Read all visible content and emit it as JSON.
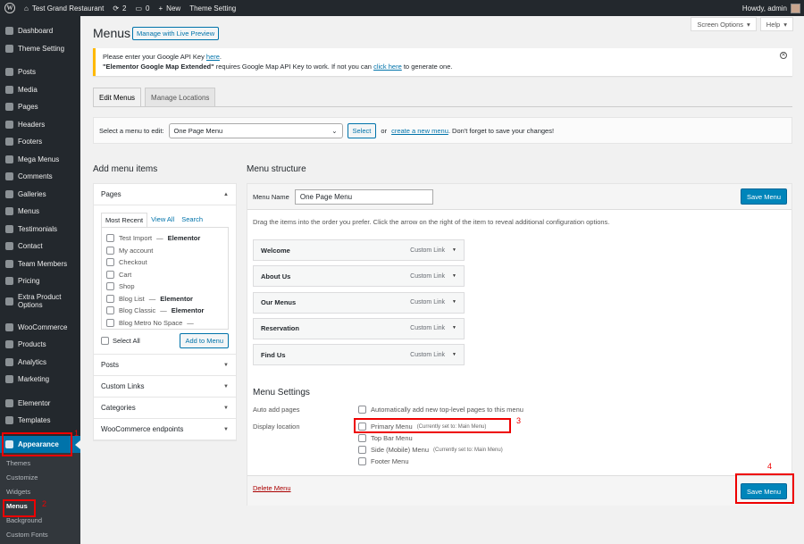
{
  "adminbar": {
    "site": "Test Grand Restaurant",
    "updates": "2",
    "comments": "0",
    "new": "New",
    "theme_setting": "Theme Setting",
    "howdy": "Howdy, admin"
  },
  "sidebar": {
    "items": [
      "Dashboard",
      "Theme Setting",
      "Posts",
      "Media",
      "Pages",
      "Headers",
      "Footers",
      "Mega Menus",
      "Comments",
      "Galleries",
      "Menus",
      "Testimonials",
      "Contact",
      "Team Members",
      "Pricing",
      "Extra Product Options",
      "WooCommerce",
      "Products",
      "Analytics",
      "Marketing",
      "Elementor",
      "Templates",
      "Appearance"
    ],
    "sub": [
      "Themes",
      "Customize",
      "Widgets",
      "Menus",
      "Background",
      "Custom Fonts"
    ]
  },
  "header": {
    "title": "Menus",
    "preview_button": "Manage with Live Preview",
    "screen_options": "Screen Options",
    "help": "Help"
  },
  "notice": {
    "line1_pre": "Please enter your Google API Key ",
    "line1_link": "here",
    "line1_post": ".",
    "line2_bold": "\"Elementor Google Map Extended\"",
    "line2_mid": " requires Google Map API Key to work. If not you can ",
    "line2_link": "click here",
    "line2_post": " to generate one."
  },
  "tabs": [
    "Edit Menus",
    "Manage Locations"
  ],
  "select_bar": {
    "label": "Select a menu to edit:",
    "selected": "One Page Menu",
    "select_button": "Select",
    "or": "or",
    "create_link": "create a new menu",
    "suffix": ". Don't forget to save your changes!"
  },
  "add_items": {
    "title": "Add menu items",
    "pages_heading": "Pages",
    "page_tabs": [
      "Most Recent",
      "View All",
      "Search"
    ],
    "pages": [
      {
        "name": "Test Import",
        "suffix": "Elementor"
      },
      {
        "name": "My account",
        "suffix": ""
      },
      {
        "name": "Checkout",
        "suffix": ""
      },
      {
        "name": "Cart",
        "suffix": ""
      },
      {
        "name": "Shop",
        "suffix": ""
      },
      {
        "name": "Blog List",
        "suffix": "Elementor"
      },
      {
        "name": "Blog Classic",
        "suffix": "Elementor"
      },
      {
        "name": "Blog Metro No Space",
        "suffix": ""
      }
    ],
    "select_all": "Select All",
    "add_button": "Add to Menu",
    "sections": [
      "Posts",
      "Custom Links",
      "Categories",
      "WooCommerce endpoints"
    ]
  },
  "structure": {
    "title": "Menu structure",
    "name_label": "Menu Name",
    "name_value": "One Page Menu",
    "save_label": "Save Menu",
    "description": "Drag the items into the order you prefer. Click the arrow on the right of the item to reveal additional configuration options.",
    "items": [
      {
        "label": "Welcome",
        "type": "Custom Link"
      },
      {
        "label": "About Us",
        "type": "Custom Link"
      },
      {
        "label": "Our Menus",
        "type": "Custom Link"
      },
      {
        "label": "Reservation",
        "type": "Custom Link"
      },
      {
        "label": "Find Us",
        "type": "Custom Link"
      }
    ]
  },
  "settings": {
    "title": "Menu Settings",
    "auto_add_label": "Auto add pages",
    "auto_add_option": "Automatically add new top-level pages to this menu",
    "display_label": "Display location",
    "locations": [
      {
        "name": "Primary Menu",
        "note": "(Currently set to: Main Menu)"
      },
      {
        "name": "Top Bar Menu",
        "note": ""
      },
      {
        "name": "Side (Mobile) Menu",
        "note": "(Currently set to: Main Menu)"
      },
      {
        "name": "Footer Menu",
        "note": ""
      }
    ],
    "delete_link": "Delete Menu"
  },
  "annotations": [
    "1",
    "2",
    "3",
    "4"
  ],
  "colors": {
    "accent": "#0073aa",
    "primary_button": "#0085ba",
    "admin_bg": "#23282d",
    "annotation": "#e00000"
  }
}
